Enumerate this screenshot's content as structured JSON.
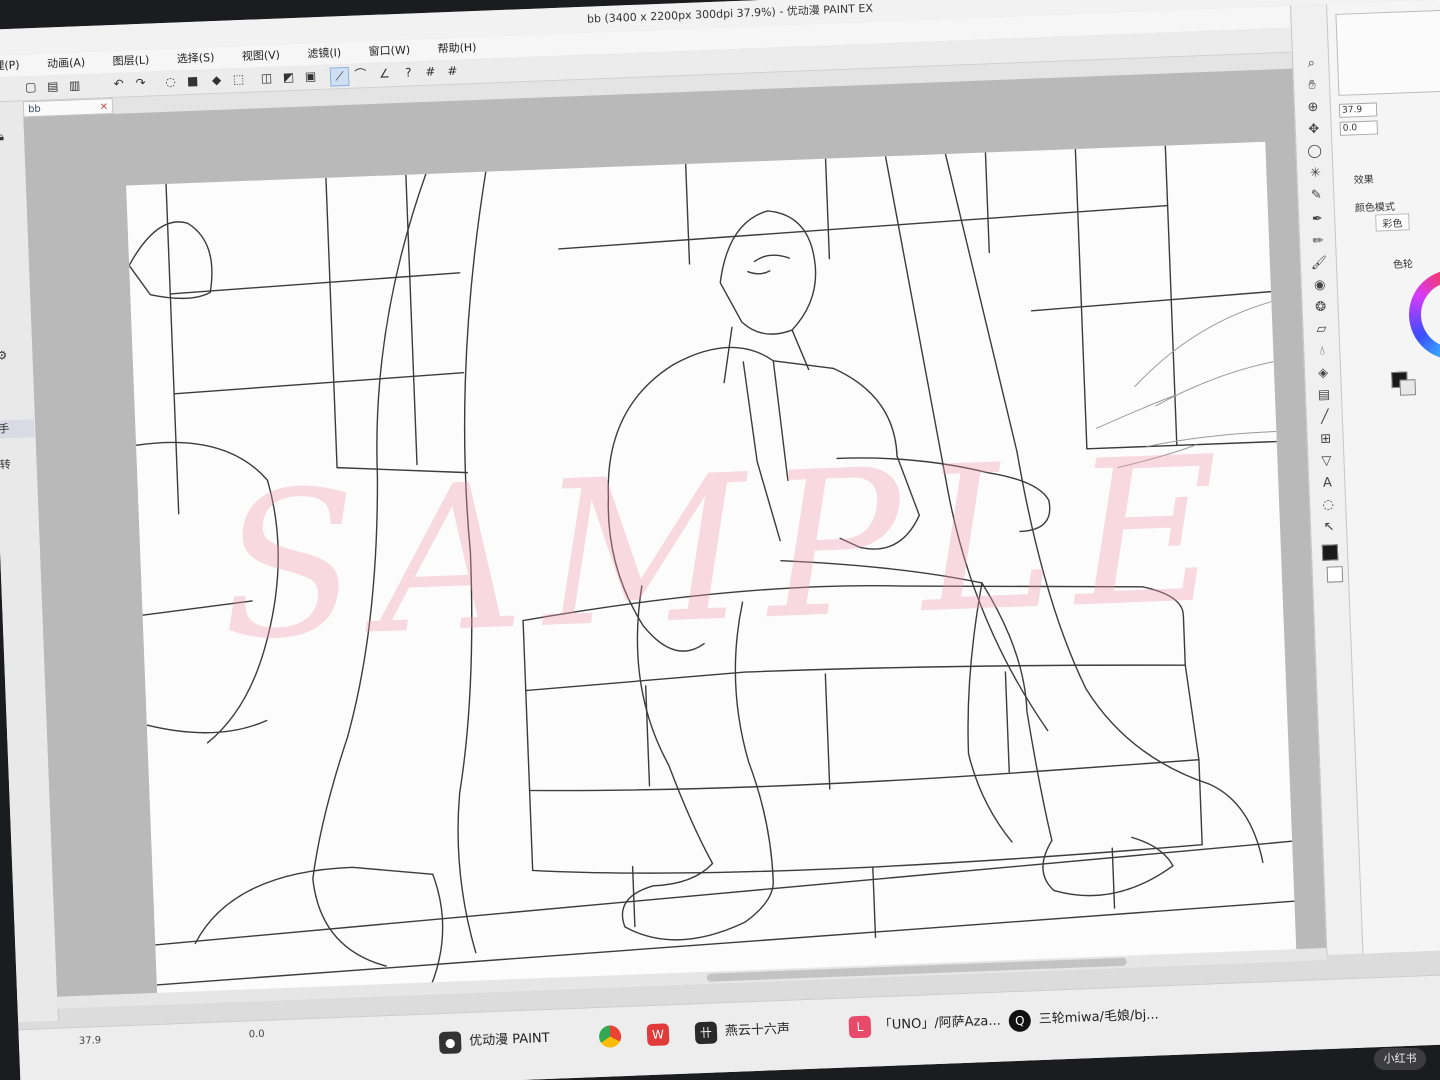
{
  "window": {
    "title": "bb (3400 x 2200px 300dpi 37.9%)  - 优动漫 PAINT EX"
  },
  "menu": {
    "items": [
      "理(P)",
      "动画(A)",
      "图层(L)",
      "选择(S)",
      "视图(V)",
      "滤镜(I)",
      "窗口(W)",
      "帮助(H)"
    ]
  },
  "tab": {
    "name": "bb",
    "close": "×"
  },
  "left_panel": {
    "label_1": "手",
    "label_2": "转"
  },
  "canvas": {
    "watermark": "SAMPLE"
  },
  "right_panel": {
    "zoom": "37.9",
    "rotation": "0.0",
    "effects_label": "效果",
    "color_mode_label": "颜色模式",
    "color_mode_value": "彩色",
    "color_wheel_label": "色轮"
  },
  "status": {
    "zoom": "37.9",
    "rotation": "0.0"
  },
  "taskbar": {
    "app_paint": "优动漫 PAINT",
    "app_yanyun": "燕云十六声",
    "app_uno": "「UNO」/阿萨Aza...",
    "app_qq": "三轮miwa/毛娘/bj...",
    "watermark": "小红书"
  },
  "colors": {
    "accent": "#8fb2dc",
    "canvas_bg": "#fcfcfc",
    "workspace_bg": "#b9b9b9",
    "watermark_pink": "#f096af"
  }
}
